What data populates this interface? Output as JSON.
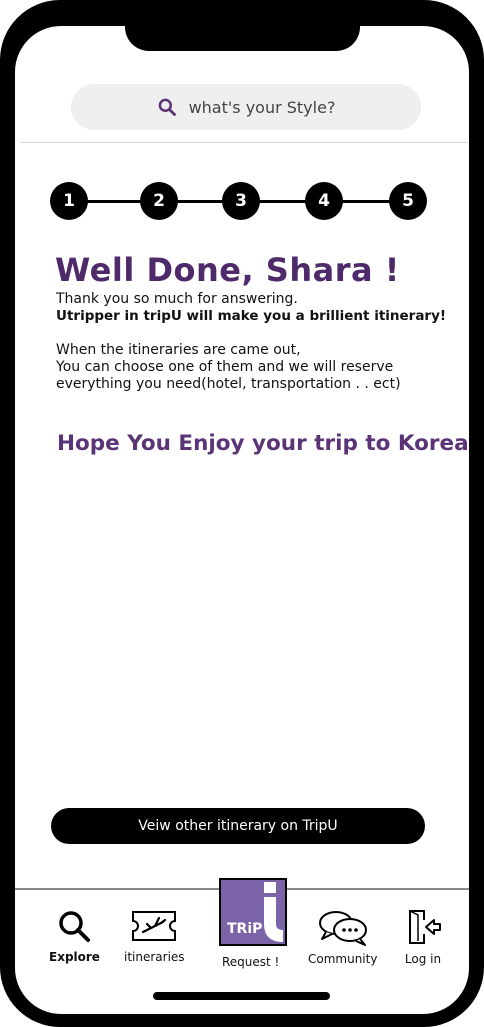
{
  "search": {
    "placeholder": "what's your Style?"
  },
  "progress": {
    "steps": [
      "1",
      "2",
      "3",
      "4",
      "5"
    ]
  },
  "heading": "Well Done, Shara !",
  "message": {
    "line1": "Thank you so much for answering.",
    "line2": "Utripper in tripU will make you a brillient itinerary!",
    "line3": "When the itineraries are came out,",
    "line4": "You can choose one of them and we will reserve",
    "line5": "everything you need(hotel, transportation . . ect)"
  },
  "tagline": "Hope You Enjoy your trip to Korea",
  "cta_label": "Veiw other itinerary on TripU",
  "nav": {
    "explore": "Explore",
    "itineraries": "itineraries",
    "request": "Request !",
    "request_logo": "TRiP",
    "community": "Community",
    "login": "Log in"
  },
  "colors": {
    "accent": "#4e2a6b",
    "logo_bg": "#7b63a8"
  }
}
